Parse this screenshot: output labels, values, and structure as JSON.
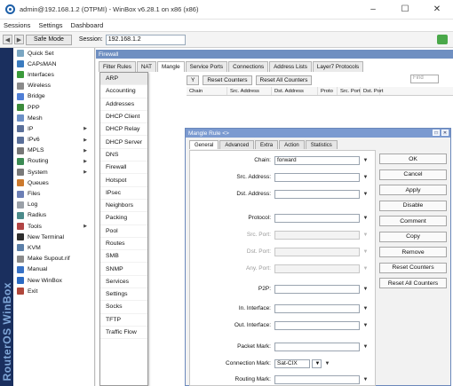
{
  "window": {
    "title": "admin@192.168.1.2 (OTPMI) - WinBox v6.28.1 on x86 (x86)",
    "minimize": "–",
    "maximize": "☐",
    "close": "✕"
  },
  "menu": [
    "Sessions",
    "Settings",
    "Dashboard"
  ],
  "toolbar": {
    "back": "◀",
    "forward": "▶",
    "safe_mode": "Safe Mode",
    "session_label": "Session:",
    "session_value": "192.168.1.2"
  },
  "brand": "RouterOS WinBox",
  "nav": [
    {
      "label": "Quick Set",
      "icon_color": "#7aa6c2",
      "arrow": false
    },
    {
      "label": "CAPsMAN",
      "icon_color": "#3a7bbf",
      "arrow": false
    },
    {
      "label": "Interfaces",
      "icon_color": "#3a9a3a",
      "arrow": false
    },
    {
      "label": "Wireless",
      "icon_color": "#8a8a8a",
      "arrow": false
    },
    {
      "label": "Bridge",
      "icon_color": "#4f7ed6",
      "arrow": false
    },
    {
      "label": "PPP",
      "icon_color": "#3b8b3b",
      "arrow": false
    },
    {
      "label": "Mesh",
      "icon_color": "#6b8fc6",
      "arrow": false
    },
    {
      "label": "IP",
      "icon_color": "#5a6f99",
      "arrow": true
    },
    {
      "label": "IPv6",
      "icon_color": "#5a6f99",
      "arrow": true
    },
    {
      "label": "MPLS",
      "icon_color": "#777777",
      "arrow": true
    },
    {
      "label": "Routing",
      "icon_color": "#3c8b54",
      "arrow": true
    },
    {
      "label": "System",
      "icon_color": "#7a7a7a",
      "arrow": true
    },
    {
      "label": "Queues",
      "icon_color": "#cc7a2e",
      "arrow": false
    },
    {
      "label": "Files",
      "icon_color": "#6c7fb6",
      "arrow": false
    },
    {
      "label": "Log",
      "icon_color": "#9aa0a8",
      "arrow": false
    },
    {
      "label": "Radius",
      "icon_color": "#4b8a8a",
      "arrow": false
    },
    {
      "label": "Tools",
      "icon_color": "#b14444",
      "arrow": true
    },
    {
      "label": "New Terminal",
      "icon_color": "#2f2f2f",
      "arrow": false
    },
    {
      "label": "KVM",
      "icon_color": "#5b7fa8",
      "arrow": false
    },
    {
      "label": "Make Supout.rif",
      "icon_color": "#8a8a8a",
      "arrow": false
    },
    {
      "label": "Manual",
      "icon_color": "#3872c6",
      "arrow": false
    },
    {
      "label": "New WinBox",
      "icon_color": "#2b6bc4",
      "arrow": false
    },
    {
      "label": "Exit",
      "icon_color": "#b0483c",
      "arrow": false
    }
  ],
  "firewall": {
    "title": "Firewall",
    "tabs": [
      "Filter Rules",
      "NAT",
      "Mangle",
      "Service Ports",
      "Connections",
      "Address Lists",
      "Layer7 Protocols"
    ],
    "active_tab": "Mangle",
    "buttons": [
      "Y",
      "Reset Counters",
      "Reset All Counters"
    ],
    "find_placeholder": "Find",
    "columns": [
      "Chain",
      "Src. Address",
      "Dst. Address",
      "Proto",
      "Src. Port",
      "Dst. Port"
    ]
  },
  "chain_menu": [
    "ARP",
    "Accounting",
    "Addresses",
    "DHCP Client",
    "DHCP Relay",
    "DHCP Server",
    "DNS",
    "Firewall",
    "Hotspot",
    "IPsec",
    "Neighbors",
    "Packing",
    "Pool",
    "Routes",
    "SMB",
    "SNMP",
    "Services",
    "Settings",
    "Socks",
    "TFTP",
    "Traffic Flow"
  ],
  "dialog": {
    "title": "Mangle Rule <>",
    "tabs": [
      "General",
      "Advanced",
      "Extra",
      "Action",
      "Statistics"
    ],
    "active_tab": "General",
    "fields": [
      {
        "label": "Chain:",
        "value": "forward",
        "disabled": false,
        "type": "drop"
      },
      {
        "label": "Src. Address:",
        "value": "",
        "disabled": false,
        "type": "drop"
      },
      {
        "label": "Dst. Address:",
        "value": "",
        "disabled": false,
        "type": "drop"
      },
      {
        "label": "Protocol:",
        "value": "",
        "disabled": false,
        "type": "drop"
      },
      {
        "label": "Src. Port:",
        "value": "",
        "disabled": true,
        "type": "drop"
      },
      {
        "label": "Dst. Port:",
        "value": "",
        "disabled": true,
        "type": "drop"
      },
      {
        "label": "Any. Port:",
        "value": "",
        "disabled": true,
        "type": "drop"
      },
      {
        "label": "P2P:",
        "value": "",
        "disabled": false,
        "type": "drop"
      },
      {
        "label": "In. Interface:",
        "value": "",
        "disabled": false,
        "type": "drop"
      },
      {
        "label": "Out. Interface:",
        "value": "",
        "disabled": false,
        "type": "drop"
      },
      {
        "label": "Packet Mark:",
        "value": "",
        "disabled": false,
        "type": "drop"
      },
      {
        "label": "Connection Mark:",
        "value": "Sat-CIX",
        "disabled": false,
        "type": "mark"
      },
      {
        "label": "Routing Mark:",
        "value": "",
        "disabled": false,
        "type": "drop"
      }
    ],
    "buttons": [
      "OK",
      "Cancel",
      "Apply",
      "Disable",
      "Comment",
      "Copy",
      "Remove",
      "Reset Counters",
      "Reset All Counters"
    ]
  }
}
